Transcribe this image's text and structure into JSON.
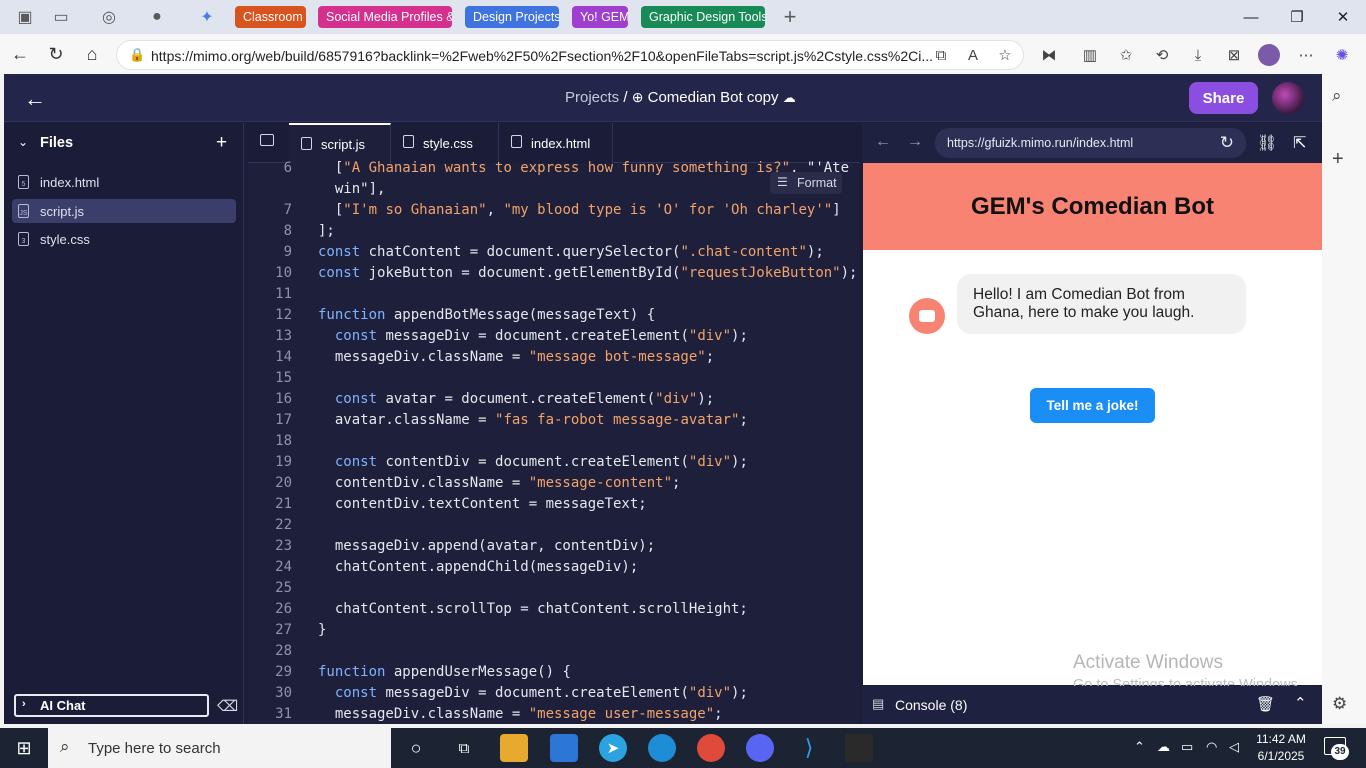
{
  "browser": {
    "tabs": [
      {
        "label": "Classroom",
        "color": "#d9531e"
      },
      {
        "label": "Social Media Profiles &",
        "color": "#d6308f"
      },
      {
        "label": "Design Projects",
        "color": "#3f73e0"
      },
      {
        "label": "Yo! GEM",
        "color": "#a03ecf"
      },
      {
        "label": "Graphic Design Tools",
        "color": "#178a55"
      }
    ],
    "url": "https://mimo.org/web/build/6857916?backlink=%2Fweb%2F50%2Fsection%2F10&openFileTabs=script.js%2Cstyle.css%2Ci..."
  },
  "header": {
    "projects": "Projects",
    "separator": "/",
    "project_name": "Comedian Bot copy",
    "share_label": "Share"
  },
  "sidebar": {
    "title": "Files",
    "files": [
      {
        "label": "index.html"
      },
      {
        "label": "script.js"
      },
      {
        "label": "style.css"
      }
    ],
    "ai_chat": "AI Chat"
  },
  "editor": {
    "tabs": [
      {
        "label": "script.js"
      },
      {
        "label": "style.css"
      },
      {
        "label": "index.html"
      }
    ],
    "format_label": "Format",
    "lines": [
      {
        "n": "6",
        "code": "  [\"A Ghanaian wants to express how funny something is?\", \"'Ate"
      },
      {
        "n": "",
        "code": "  win\"],"
      },
      {
        "n": "7",
        "code": "  [\"I'm so Ghanaian\", \"my blood type is 'O' for 'Oh charley'\"]"
      },
      {
        "n": "8",
        "code": "];"
      },
      {
        "n": "9",
        "code": "const chatContent = document.querySelector(\".chat-content\");"
      },
      {
        "n": "10",
        "code": "const jokeButton = document.getElementById(\"requestJokeButton\");"
      },
      {
        "n": "11",
        "code": ""
      },
      {
        "n": "12",
        "code": "function appendBotMessage(messageText) {"
      },
      {
        "n": "13",
        "code": "  const messageDiv = document.createElement(\"div\");"
      },
      {
        "n": "14",
        "code": "  messageDiv.className = \"message bot-message\";"
      },
      {
        "n": "15",
        "code": ""
      },
      {
        "n": "16",
        "code": "  const avatar = document.createElement(\"div\");"
      },
      {
        "n": "17",
        "code": "  avatar.className = \"fas fa-robot message-avatar\";"
      },
      {
        "n": "18",
        "code": ""
      },
      {
        "n": "19",
        "code": "  const contentDiv = document.createElement(\"div\");"
      },
      {
        "n": "20",
        "code": "  contentDiv.className = \"message-content\";"
      },
      {
        "n": "21",
        "code": "  contentDiv.textContent = messageText;"
      },
      {
        "n": "22",
        "code": ""
      },
      {
        "n": "23",
        "code": "  messageDiv.append(avatar, contentDiv);"
      },
      {
        "n": "24",
        "code": "  chatContent.appendChild(messageDiv);"
      },
      {
        "n": "25",
        "code": ""
      },
      {
        "n": "26",
        "code": "  chatContent.scrollTop = chatContent.scrollHeight;"
      },
      {
        "n": "27",
        "code": "}"
      },
      {
        "n": "28",
        "code": ""
      },
      {
        "n": "29",
        "code": "function appendUserMessage() {"
      },
      {
        "n": "30",
        "code": "  const messageDiv = document.createElement(\"div\");"
      },
      {
        "n": "31",
        "code": "  messageDiv.className = \"message user-message\";"
      }
    ]
  },
  "preview": {
    "url": "https://gfuizk.mimo.run/index.html",
    "title": "GEM's Comedian Bot",
    "bot_message": "Hello! I am Comedian Bot from Ghana, here to make you laugh.",
    "joke_button": "Tell me a joke!",
    "console_label": "Console (8)"
  },
  "watermark": {
    "line1": "Activate Windows",
    "line2": "Go to Settings to activate Windows."
  },
  "taskbar": {
    "search_placeholder": "Type here to search",
    "time": "11:42 AM",
    "date": "6/1/2025",
    "notifications": "39"
  }
}
